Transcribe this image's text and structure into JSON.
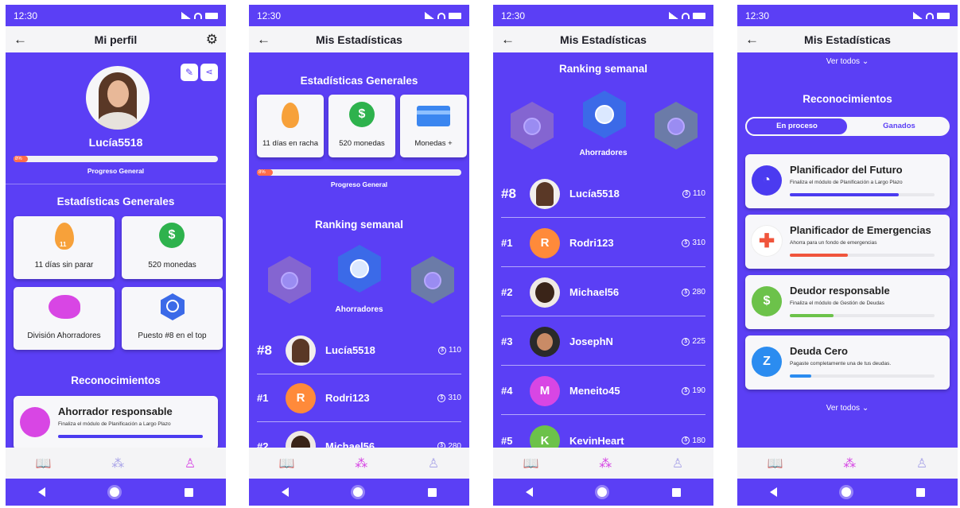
{
  "status_time": "12:30",
  "screens": {
    "profile": {
      "title": "Mi perfil",
      "username": "Lucía5518",
      "progress": {
        "label": "Progreso General",
        "percent_text": "8%",
        "value": 8
      },
      "stats_title": "Estadísticas Generales",
      "stats": [
        {
          "label": "11 días sin parar",
          "icon": "flame-icon",
          "badge": "11"
        },
        {
          "label": "520 monedas",
          "icon": "dollar-coin-icon"
        },
        {
          "label": "División Ahorradores",
          "icon": "piggy-bank-icon"
        },
        {
          "label": "Puesto #8 en el top",
          "icon": "hexagon-badge-icon"
        }
      ],
      "rec_title": "Reconocimientos",
      "recognition": {
        "title": "Ahorrador responsable",
        "desc": "Finaliza el módulo de Planificación a Largo Plazo",
        "progress": 100
      }
    },
    "stats": {
      "title": "Mis Estadísticas",
      "stats_title": "Estadísticas Generales",
      "stats": [
        {
          "label": "11 días en racha",
          "icon": "flame-icon",
          "badge": "11"
        },
        {
          "label": "520 monedas",
          "icon": "dollar-coin-icon"
        },
        {
          "label": "Monedas +",
          "icon": "credit-card-icon"
        }
      ],
      "progress": {
        "label": "Progreso General",
        "percent_text": "8%",
        "value": 8
      },
      "ranking_title": "Ranking semanal",
      "division": "Ahorradores",
      "rows": [
        {
          "pos": "#8",
          "name": "Lucía5518",
          "coins": "110"
        },
        {
          "pos": "#1",
          "name": "Rodri123",
          "coins": "310",
          "initial": "R"
        },
        {
          "pos": "#2",
          "name": "Michael56",
          "coins": "280"
        }
      ]
    },
    "ranking": {
      "title": "Mis Estadísticas",
      "ranking_title": "Ranking semanal",
      "division": "Ahorradores",
      "rows": [
        {
          "pos": "#8",
          "name": "Lucía5518",
          "coins": "110"
        },
        {
          "pos": "#1",
          "name": "Rodri123",
          "coins": "310",
          "initial": "R"
        },
        {
          "pos": "#2",
          "name": "Michael56",
          "coins": "280"
        },
        {
          "pos": "#3",
          "name": "JosephN",
          "coins": "225"
        },
        {
          "pos": "#4",
          "name": "Meneito45",
          "coins": "190",
          "initial": "M"
        },
        {
          "pos": "#5",
          "name": "KevinHeart",
          "coins": "180",
          "initial": "K"
        }
      ]
    },
    "recognitions": {
      "title": "Mis Estadísticas",
      "see_all": "Ver todos",
      "rec_title": "Reconocimientos",
      "tabs": {
        "in_progress": "En proceso",
        "won": "Ganados"
      },
      "items": [
        {
          "title": "Planificador del Futuro",
          "desc": "Finaliza el módulo de Planificación a Largo Plazo",
          "progress": 75,
          "color": "#4b3bf0",
          "icon": "clock-icon"
        },
        {
          "title": "Planificador de Emergencias",
          "desc": "Ahorra para un fondo de emergencias",
          "progress": 40,
          "color": "#f0553c",
          "icon": "medical-cross-icon"
        },
        {
          "title": "Deudor responsable",
          "desc": "Finaliza el módulo de Gestión de Deudas",
          "progress": 30,
          "color": "#6cc24a",
          "icon": "money-hand-icon"
        },
        {
          "title": "Deuda Cero",
          "desc": "Pagaste completamente una de tus deudas.",
          "progress": 15,
          "color": "#2b8cf0",
          "icon": "z-letter-icon",
          "letter": "Z"
        }
      ],
      "see_all_bottom": "Ver todos"
    }
  },
  "colors": {
    "primary": "#5b3ff5",
    "accent": "#d646e4",
    "progress": "#ff6b4a"
  }
}
